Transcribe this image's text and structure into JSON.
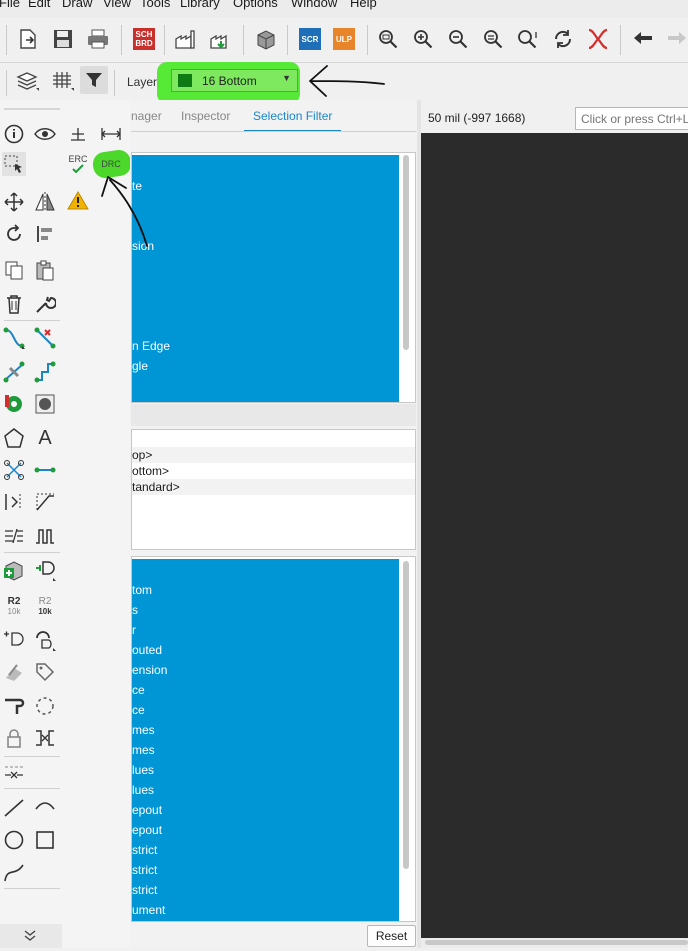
{
  "menu": {
    "items": [
      "File",
      "Edit",
      "Draw",
      "View",
      "Tools",
      "Library",
      "Options",
      "Window",
      "Help"
    ]
  },
  "toolbar": {
    "sch_brd_badge": [
      "SCH",
      "BRD"
    ],
    "scr_badge": "SCR",
    "ulp_badge": "ULP",
    "icons": [
      "open-icon",
      "save-icon",
      "print-icon",
      "sch-brd-switch-icon",
      "cam-icon",
      "manufacturing-icon",
      "3d-icon",
      "script-icon",
      "ulp-icon",
      "zoom-fit-icon",
      "zoom-in-icon",
      "zoom-out-icon",
      "zoom-select-icon",
      "zoom-last-icon",
      "redraw-icon",
      "stop-icon",
      "undo-icon",
      "redo-icon"
    ],
    "colors": {
      "sch": "#c9302c",
      "scr": "#1f6fb8",
      "ulp": "#e8842a",
      "stop": "#d32f2f"
    }
  },
  "layer_bar": {
    "label": "Layer:",
    "selected_layer": "16 Bottom",
    "swatch_color": "#0d7a13",
    "highlight_color": "#56ea36"
  },
  "tools": {
    "erc_label": "ERC",
    "drc_label": "DRC",
    "r2_label": "R2",
    "r2_value": "10k",
    "text_tool_glyph": "A"
  },
  "panel": {
    "tabs": [
      {
        "label": "nager"
      },
      {
        "label": "Inspector"
      },
      {
        "label": "Selection Filter"
      }
    ],
    "list1": [
      "te",
      "sion",
      "n Edge",
      "gle"
    ],
    "list2": [
      "op>",
      "ottom>",
      "tandard>"
    ],
    "list3": [
      "tom",
      "s",
      "r",
      "outed",
      "ension",
      "ce",
      "ce",
      "mes",
      "mes",
      "lues",
      "lues",
      "epout",
      "epout",
      "strict",
      "strict",
      "strict",
      "ument"
    ],
    "reset_label": "Reset",
    "selection_color": "#0096d6"
  },
  "status": {
    "coordinates": "50 mil (-997 1668)",
    "command_placeholder": "Click or press Ctrl+L"
  }
}
